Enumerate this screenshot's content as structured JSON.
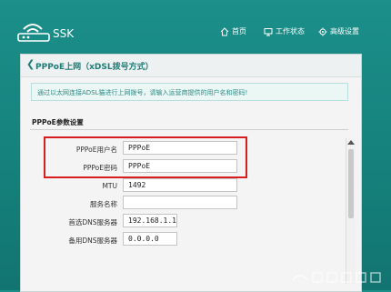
{
  "header": {
    "brand": "SSK",
    "nav": [
      {
        "label": "首页",
        "icon": "home-icon"
      },
      {
        "label": "工作状态",
        "icon": "monitor-icon"
      },
      {
        "label": "高级设置",
        "icon": "gear-icon"
      }
    ]
  },
  "panel": {
    "back_glyph": "❮",
    "title": "PPPoE上网（xDSL拨号方式）",
    "notice": "通过以太网连接ADSL猫进行上网拨号，请输入运营商提供的用户名和密码!",
    "section_title": "PPPoE参数设置",
    "fields": [
      {
        "label": "PPPoE用户名",
        "value": "PPPoE"
      },
      {
        "label": "PPPoE密码",
        "value": "PPPoE"
      },
      {
        "label": "MTU",
        "value": "1492"
      },
      {
        "label": "服务名称",
        "value": ""
      },
      {
        "label": "首选DNS服务器",
        "value": "192.168.1.1"
      },
      {
        "label": "备用DNS服务器",
        "value": "0.0.0.0"
      }
    ]
  },
  "colors": {
    "background": "#1c8f8a",
    "accent": "#1f7c77",
    "highlight": "#d61e1e"
  }
}
